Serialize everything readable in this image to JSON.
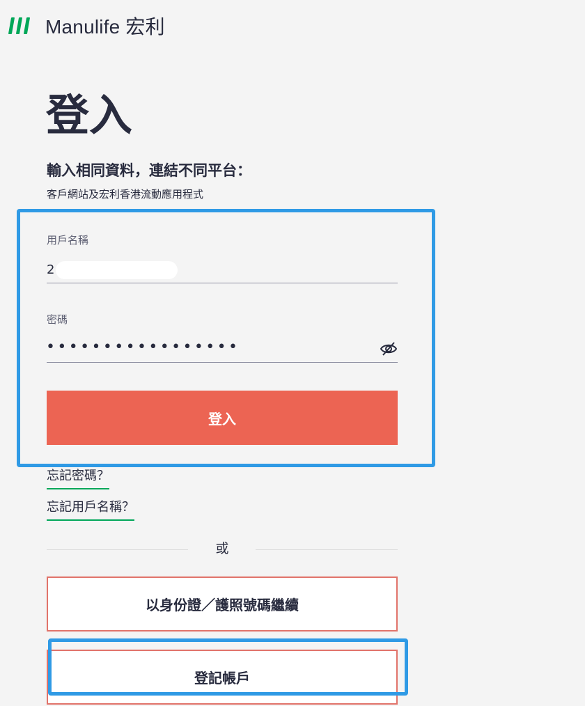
{
  "brand": {
    "name": "Manulife 宏利",
    "accent_color": "#00a758",
    "primary_button_color": "#ec6453",
    "highlight_color": "#2f9ae5"
  },
  "page": {
    "title": "登入",
    "subtitle": "輸入相同資料，連結不同平台：",
    "caption": "客戶網站及宏利香港流動應用程式"
  },
  "form": {
    "username": {
      "label": "用戶名稱",
      "value": "2"
    },
    "password": {
      "label": "密碼",
      "value": "•••••••••••••••••",
      "toggle_icon": "eye-slash-icon"
    },
    "submit_label": "登入"
  },
  "links": {
    "forgot_password": "忘記密碼？",
    "forgot_username": "忘記用戶名稱？"
  },
  "divider": {
    "label": "或"
  },
  "alternatives": {
    "id_passport_label": "以身份證／護照號碼繼續",
    "register_label": "登記帳戶"
  }
}
